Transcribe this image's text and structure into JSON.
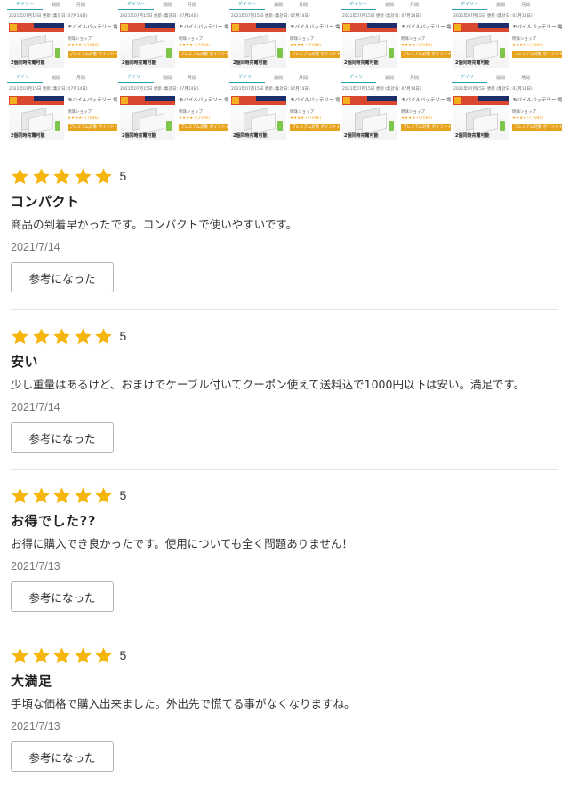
{
  "ranking_widget": {
    "tabs": [
      "デイリー",
      "週間",
      "月間"
    ],
    "meta": "2021年07月15日 更新 (集計日: 07月14日)",
    "product_title": "モバイルバッテリー 電源/充電",
    "thumb_label": "12000mAh",
    "thumb_foot": "2個同時充電可能",
    "shop": "明珠ショップ",
    "stars": "★★★★☆(7086)",
    "promo": "プレミアム対象 ポイント+9%",
    "count": 10
  },
  "reviews": [
    {
      "rating": "5",
      "title": "コンパクト",
      "body": "商品の到着早かったです。コンパクトで使いやすいです。",
      "date": "2021/7/14",
      "helpful_label": "参考になった"
    },
    {
      "rating": "5",
      "title": "安い",
      "body": "少し重量はあるけど、おまけでケーブル付いてクーポン使えて送料込で1000円以下は安い。満足です。",
      "date": "2021/7/14",
      "helpful_label": "参考になった"
    },
    {
      "rating": "5",
      "title": "お得でした??",
      "body": "お得に購入でき良かったです。使用についても全く問題ありません！",
      "date": "2021/7/13",
      "helpful_label": "参考になった"
    },
    {
      "rating": "5",
      "title": "大満足",
      "body": "手頃な価格で購入出来ました。外出先で慌てる事がなくなりますね。",
      "date": "2021/7/13",
      "helpful_label": "参考になった"
    }
  ],
  "colors": {
    "star": "#f5b50a",
    "accent": "#2aa0b4"
  },
  "icons": {
    "star": "star-icon"
  }
}
